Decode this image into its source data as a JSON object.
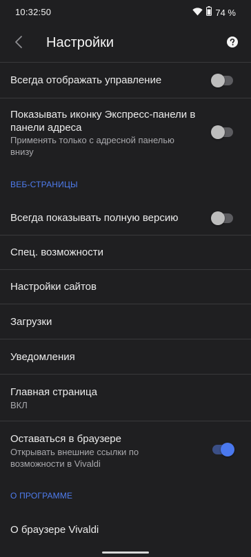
{
  "status_bar": {
    "time": "10:32:50",
    "battery_percent": "74 %",
    "icons": [
      "wifi-icon",
      "battery-icon"
    ]
  },
  "app_bar": {
    "title": "Настройки",
    "back_icon": "chevron-left-icon",
    "help_icon": "help-circle-icon"
  },
  "settings": {
    "always_show_controls": {
      "title": "Всегда отображать управление",
      "enabled": false
    },
    "speed_dial_icon": {
      "title_line1": "Показывать иконку Экспресс-панели в",
      "title_line2": "панели адреса",
      "subtitle_line1": "Применять только с адресной панелью",
      "subtitle_line2": "внизу",
      "enabled": false
    },
    "web_pages_header": "ВЕБ-СТРАНИЦЫ",
    "desktop_version": {
      "title": "Всегда показывать полную версию",
      "enabled": false
    },
    "accessibility": {
      "title": "Спец. возможности"
    },
    "site_settings": {
      "title": "Настройки сайтов"
    },
    "downloads": {
      "title": "Загрузки"
    },
    "notifications": {
      "title": "Уведомления"
    },
    "homepage": {
      "title": "Главная страница",
      "value": "ВКЛ"
    },
    "stay_in_browser": {
      "title": "Оставаться в браузере",
      "subtitle_line1": "Открывать внешние ссылки по",
      "subtitle_line2": "возможности в Vivaldi",
      "enabled": true
    },
    "about_header": "О ПРОГРАММЕ",
    "about_vivaldi": {
      "title": "О браузере Vivaldi"
    }
  },
  "colors": {
    "background": "#1f1f21",
    "accent": "#4f7df0",
    "divider": "#3a3a3c"
  }
}
